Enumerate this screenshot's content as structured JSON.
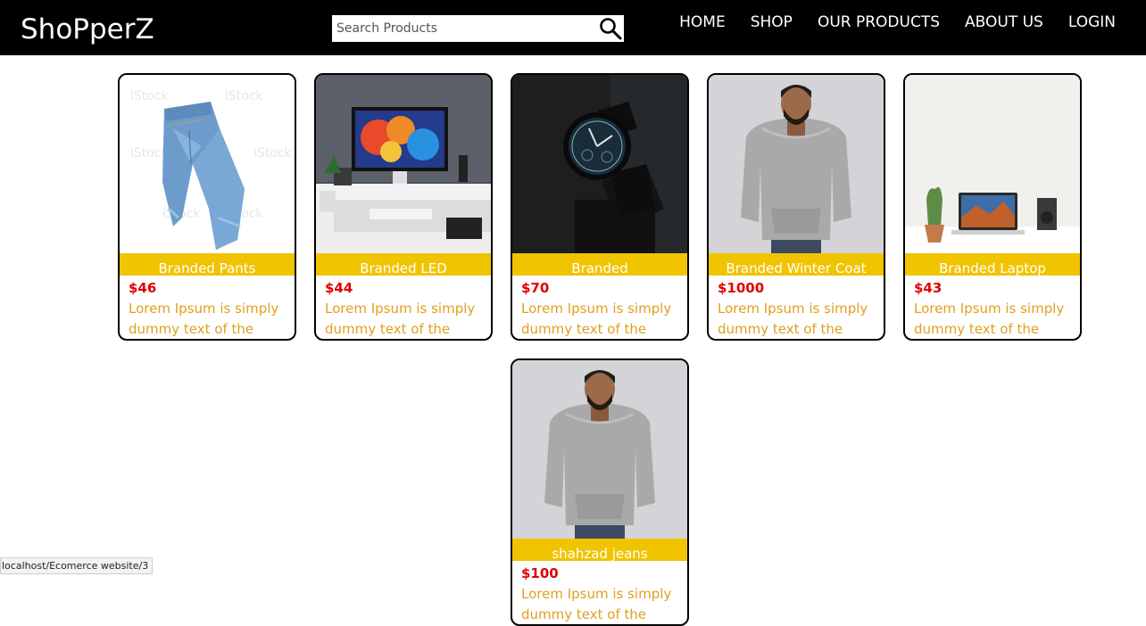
{
  "header": {
    "brand": "ShoPperZ",
    "search_placeholder": "Search Products",
    "nav": [
      "HOME",
      "SHOP",
      "OUR PRODUCTS",
      "ABOUT US",
      "LOGIN"
    ]
  },
  "products": [
    {
      "title": "Branded Pants",
      "price": "$46",
      "desc": "Lorem Ipsum is simply dummy text of the",
      "image": "jeans-image"
    },
    {
      "title": "Branded LED",
      "price": "$44",
      "desc": "Lorem Ipsum is simply dummy text of the",
      "image": "monitor-desk-image"
    },
    {
      "title": "Branded",
      "price": "$70",
      "desc": "Lorem Ipsum is simply dummy text of the",
      "image": "watch-image"
    },
    {
      "title": "Branded Winter Coat",
      "price": "$1000",
      "desc": "Lorem Ipsum is simply dummy text of the",
      "image": "hoodie-man-image"
    },
    {
      "title": "Branded Laptop",
      "price": "$43",
      "desc": "Lorem Ipsum is simply dummy text of the",
      "image": "laptop-desk-image"
    },
    {
      "title": "shahzad jeans",
      "price": "$100",
      "desc": "Lorem Ipsum is simply dummy text of the",
      "image": "hoodie-man-image"
    }
  ],
  "status_bar": {
    "url": "localhost/Ecomerce website/3"
  },
  "colors": {
    "navbar": "#000000",
    "title_band": "#f0c400",
    "price": "#e00000",
    "desc": "#e0a020"
  }
}
